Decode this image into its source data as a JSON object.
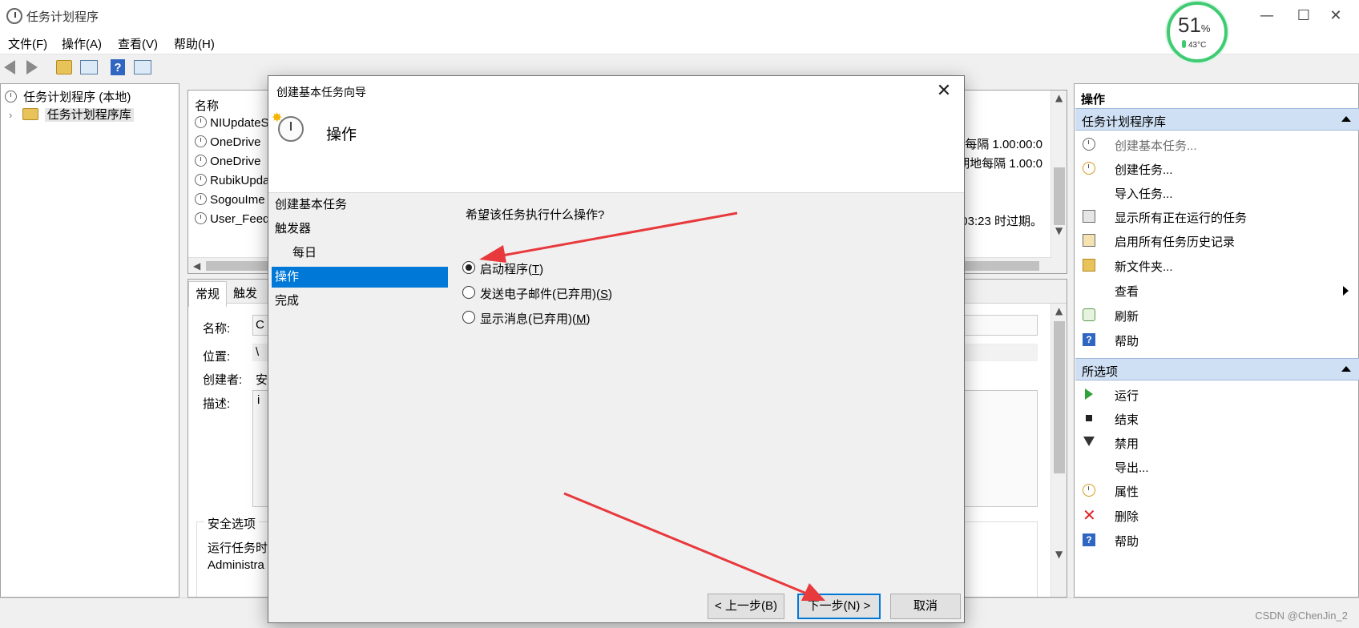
{
  "window": {
    "title": "任务计划程序",
    "minimize": "—",
    "maximize": "☐",
    "close": "✕"
  },
  "menu": [
    "文件(F)",
    "操作(A)",
    "查看(V)",
    "帮助(H)"
  ],
  "toolbar": {
    "back_icon": "back-arrow-icon",
    "forward_icon": "forward-arrow-icon",
    "help_glyph": "?"
  },
  "tree": {
    "root": "任务计划程序 (本地)",
    "library": "任务计划程序库",
    "expander": "›"
  },
  "task_list": {
    "header": "名称",
    "rows": [
      "NIUpdateS",
      "OneDrive",
      "OneDrive",
      "RubikUpda",
      "SogouIme",
      "User_Feed"
    ],
    "right_cells": [
      "地每隔 1.00:00:0",
      "期地每隔 1.00:0",
      "03:23 时过期。"
    ]
  },
  "detail": {
    "tabs": [
      "常规",
      "触发"
    ],
    "name_label": "名称:",
    "name_value": "C",
    "location_label": "位置:",
    "location_value": "\\",
    "author_label": "创建者:",
    "author_value": "安",
    "desc_label": "描述:",
    "desc_value": "i",
    "security_label": "安全选项",
    "run_as_label": "运行任务时",
    "account_value": "Administra"
  },
  "actions_panel": {
    "title": "操作",
    "section1": "任务计划程序库",
    "items1": [
      {
        "label": "创建基本任务...",
        "icon": "create-basic-task-icon",
        "disabled": true
      },
      {
        "label": "创建任务...",
        "icon": "create-task-icon"
      },
      {
        "label": "导入任务...",
        "icon": ""
      },
      {
        "label": "显示所有正在运行的任务",
        "icon": "running-tasks-icon"
      },
      {
        "label": "启用所有任务历史记录",
        "icon": "history-icon"
      },
      {
        "label": "新文件夹...",
        "icon": "new-folder-icon"
      },
      {
        "label": "查看",
        "icon": "",
        "submenu": true
      },
      {
        "label": "刷新",
        "icon": "refresh-icon"
      },
      {
        "label": "帮助",
        "icon": "help-icon"
      }
    ],
    "section2": "所选项",
    "items2": [
      {
        "label": "运行",
        "icon": "run-icon"
      },
      {
        "label": "结束",
        "icon": "end-icon"
      },
      {
        "label": "禁用",
        "icon": "disable-icon"
      },
      {
        "label": "导出...",
        "icon": ""
      },
      {
        "label": "属性",
        "icon": "properties-icon"
      },
      {
        "label": "删除",
        "icon": "delete-icon"
      },
      {
        "label": "帮助",
        "icon": "help-icon"
      }
    ]
  },
  "gauge": {
    "percent": "51",
    "unit": "%",
    "temp": "43°C"
  },
  "dialog": {
    "title": "创建基本任务向导",
    "heading": "操作",
    "close": "✕",
    "steps": [
      {
        "label": "创建基本任务",
        "sub": false,
        "active": false
      },
      {
        "label": "触发器",
        "sub": false,
        "active": false
      },
      {
        "label": "每日",
        "sub": true,
        "active": false
      },
      {
        "label": "操作",
        "sub": false,
        "active": true
      },
      {
        "label": "完成",
        "sub": false,
        "active": false
      }
    ],
    "question": "希望该任务执行什么操作?",
    "options": [
      {
        "prefix": "启动程序(",
        "key": "T",
        "suffix": ")",
        "checked": true
      },
      {
        "prefix": "发送电子邮件(已弃用)(",
        "key": "S",
        "suffix": ")",
        "checked": false
      },
      {
        "prefix": "显示消息(已弃用)(",
        "key": "M",
        "suffix": ")",
        "checked": false
      }
    ],
    "buttons": {
      "back": "< 上一步(B)",
      "next": "下一步(N) >",
      "cancel": "取消"
    }
  },
  "watermark": "CSDN @ChenJin_2",
  "colors": {
    "selection": "#0078d7",
    "section_header": "#cfe0f4",
    "annotation_arrow": "#e8393c",
    "gauge_ring": "#3fcb72"
  }
}
